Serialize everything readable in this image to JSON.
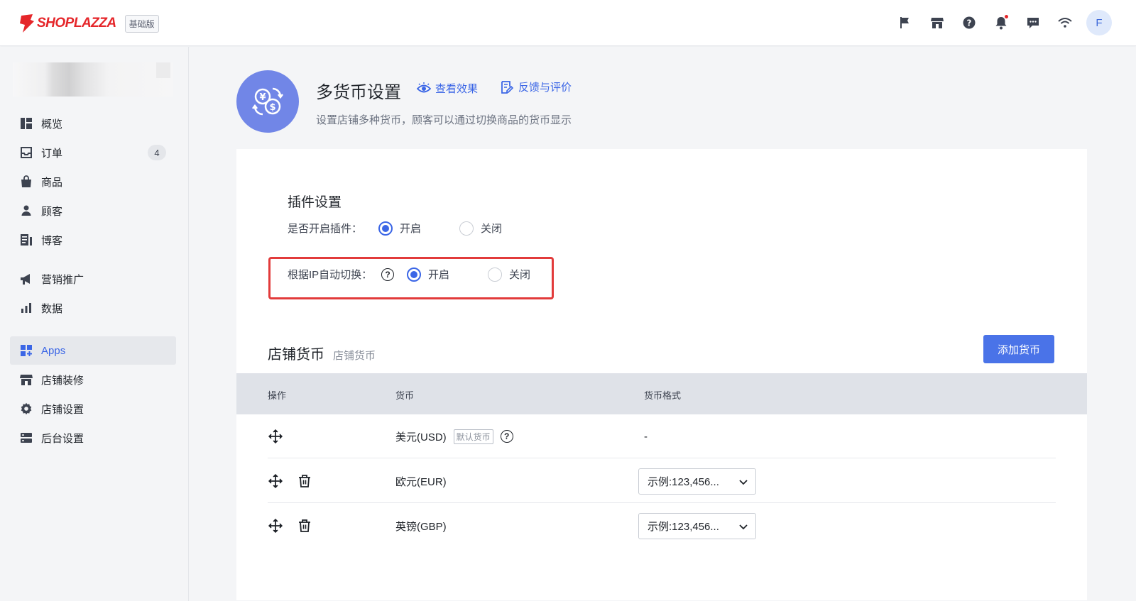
{
  "brand": {
    "name": "SHOPLAZZA",
    "plan": "基础版"
  },
  "topbar": {
    "icons": [
      "flag-icon",
      "store-icon",
      "help-icon",
      "bell-icon",
      "chat-icon",
      "wifi-icon"
    ],
    "avatar_initial": "F"
  },
  "sidebar": {
    "items": [
      {
        "label": "概览",
        "icon": "overview-icon"
      },
      {
        "label": "订单",
        "icon": "inbox-icon",
        "count": "4"
      },
      {
        "label": "商品",
        "icon": "bag-icon"
      },
      {
        "label": "顾客",
        "icon": "person-icon"
      },
      {
        "label": "博客",
        "icon": "blog-icon"
      },
      {
        "label": "营销推广",
        "icon": "megaphone-icon"
      },
      {
        "label": "数据",
        "icon": "bar-chart-icon"
      },
      {
        "label": "Apps",
        "icon": "apps-icon",
        "active": true
      },
      {
        "label": "店铺装修",
        "icon": "storefront-icon"
      },
      {
        "label": "店铺设置",
        "icon": "gear-icon"
      },
      {
        "label": "后台设置",
        "icon": "server-icon"
      }
    ]
  },
  "header": {
    "title": "多货币设置",
    "view_effect": "查看效果",
    "feedback": "反馈与评价",
    "subtitle": "设置店铺多种货币，顾客可以通过切换商品的货币显示"
  },
  "plugin_settings": {
    "title": "插件设置",
    "enable_label": "是否开启插件：",
    "auto_switch_label": "根据IP自动切换：",
    "on": "开启",
    "off": "关闭",
    "enable_value": "开启",
    "auto_switch_value": "开启"
  },
  "store_currency": {
    "title": "店铺货币",
    "subtitle": "店铺货币",
    "add_button": "添加货币",
    "columns": [
      "操作",
      "货币",
      "货币格式"
    ],
    "rows": [
      {
        "currency": "美元(USD)",
        "default_tag": "默认货币",
        "format": "-"
      },
      {
        "currency": "欧元(EUR)",
        "format": "示例:123,456..."
      },
      {
        "currency": "英镑(GBP)",
        "format": "示例:123,456..."
      }
    ]
  },
  "colors": {
    "accent": "#3b66e6",
    "brand": "#e5262a",
    "app_logo_bg": "#7186e7",
    "highlight": "#e23b3b"
  }
}
